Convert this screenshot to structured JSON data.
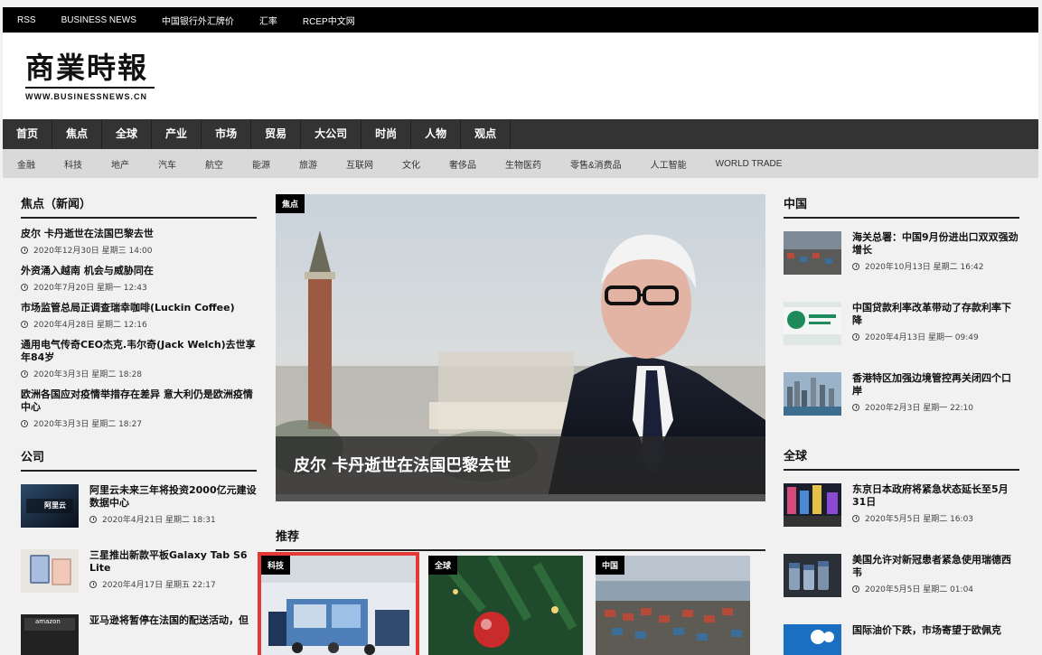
{
  "topbar": {
    "links": [
      "RSS",
      "BUSINESS NEWS",
      "中国银行外汇牌价",
      "汇率",
      "RCEP中文网"
    ]
  },
  "logo": {
    "title_cn": "商業時報",
    "title_en": "WWW.BUSINESSNEWS.CN"
  },
  "mainnav": [
    "首页",
    "焦点",
    "全球",
    "产业",
    "市场",
    "贸易",
    "大公司",
    "时尚",
    "人物",
    "观点"
  ],
  "subnav": [
    "金融",
    "科技",
    "地产",
    "汽车",
    "航空",
    "能源",
    "旅游",
    "互联网",
    "文化",
    "奢侈品",
    "生物医药",
    "零售&消费品",
    "人工智能",
    "WORLD TRADE"
  ],
  "left": {
    "focus_title": "焦点（新闻）",
    "focus_items": [
      {
        "title": "皮尔 卡丹逝世在法国巴黎去世",
        "date": "2020年12月30日 星期三 14:00"
      },
      {
        "title": "外资涌入越南 机会与威胁同在",
        "date": "2020年7月20日 星期一 12:43"
      },
      {
        "title": "市场监管总局正调查瑞幸咖啡(Luckin Coffee)",
        "date": "2020年4月28日 星期二 12:16"
      },
      {
        "title": "通用电气传奇CEO杰克.韦尔奇(Jack Welch)去世享年84岁",
        "date": "2020年3月3日 星期二 18:28"
      },
      {
        "title": "欧洲各国应对疫情举措存在差异 意大利仍是欧洲疫情中心",
        "date": "2020年3月3日 星期二 18:27"
      }
    ],
    "company_title": "公司",
    "company_items": [
      {
        "title": "阿里云未来三年将投资2000亿元建设数据中心",
        "date": "2020年4月21日 星期二 18:31",
        "thumb_text": "阿里云"
      },
      {
        "title": "三星推出新款平板Galaxy Tab S6 Lite",
        "date": "2020年4月17日 星期五 22:17",
        "thumb_text": ""
      },
      {
        "title": "亚马逊将暂停在法国的配送活动，但",
        "date": "",
        "thumb_text": "amazon"
      }
    ]
  },
  "center": {
    "hero_tag": "焦点",
    "hero_caption": "皮尔 卡丹逝世在法国巴黎去世",
    "recommend_title": "推荐",
    "rec_cards": [
      {
        "tag": "科技"
      },
      {
        "tag": "全球"
      },
      {
        "tag": "中国"
      }
    ]
  },
  "right": {
    "china_title": "中国",
    "china_items": [
      {
        "title": "海关总署：中国9月份进出口双双强劲增长",
        "date": "2020年10月13日 星期二 16:42"
      },
      {
        "title": "中国贷款利率改革带动了存款利率下降",
        "date": "2020年4月13日 星期一 09:49"
      },
      {
        "title": "香港特区加强边境管控再关闭四个口岸",
        "date": "2020年2月3日 星期一 22:10"
      }
    ],
    "global_title": "全球",
    "global_items": [
      {
        "title": "东京日本政府将紧急状态延长至5月31日",
        "date": "2020年5月5日 星期二 16:03"
      },
      {
        "title": "美国允许对新冠患者紧急使用瑞德西韦",
        "date": "2020年5月5日 星期二 01:04"
      },
      {
        "title": "国际油价下跌，市场寄望于欧佩克",
        "date": ""
      }
    ]
  }
}
